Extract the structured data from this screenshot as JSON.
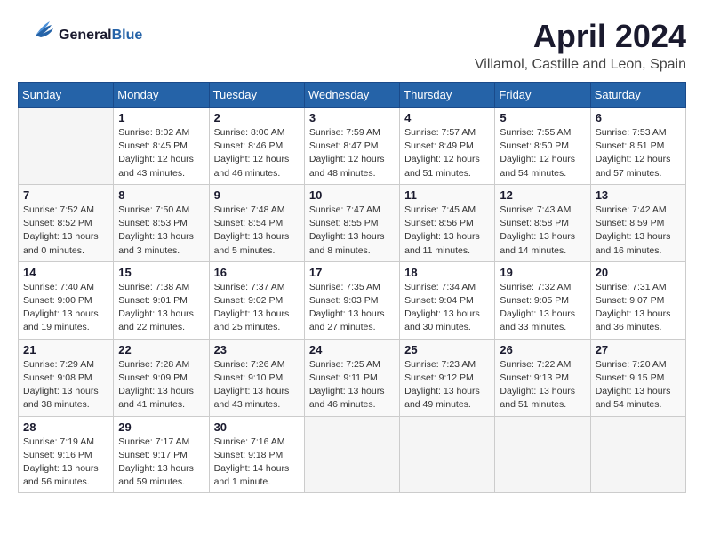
{
  "header": {
    "logo_line1": "General",
    "logo_line2": "Blue",
    "month_title": "April 2024",
    "location": "Villamol, Castille and Leon, Spain"
  },
  "weekdays": [
    "Sunday",
    "Monday",
    "Tuesday",
    "Wednesday",
    "Thursday",
    "Friday",
    "Saturday"
  ],
  "weeks": [
    [
      {
        "day": "",
        "info": ""
      },
      {
        "day": "1",
        "info": "Sunrise: 8:02 AM\nSunset: 8:45 PM\nDaylight: 12 hours\nand 43 minutes."
      },
      {
        "day": "2",
        "info": "Sunrise: 8:00 AM\nSunset: 8:46 PM\nDaylight: 12 hours\nand 46 minutes."
      },
      {
        "day": "3",
        "info": "Sunrise: 7:59 AM\nSunset: 8:47 PM\nDaylight: 12 hours\nand 48 minutes."
      },
      {
        "day": "4",
        "info": "Sunrise: 7:57 AM\nSunset: 8:49 PM\nDaylight: 12 hours\nand 51 minutes."
      },
      {
        "day": "5",
        "info": "Sunrise: 7:55 AM\nSunset: 8:50 PM\nDaylight: 12 hours\nand 54 minutes."
      },
      {
        "day": "6",
        "info": "Sunrise: 7:53 AM\nSunset: 8:51 PM\nDaylight: 12 hours\nand 57 minutes."
      }
    ],
    [
      {
        "day": "7",
        "info": "Sunrise: 7:52 AM\nSunset: 8:52 PM\nDaylight: 13 hours\nand 0 minutes."
      },
      {
        "day": "8",
        "info": "Sunrise: 7:50 AM\nSunset: 8:53 PM\nDaylight: 13 hours\nand 3 minutes."
      },
      {
        "day": "9",
        "info": "Sunrise: 7:48 AM\nSunset: 8:54 PM\nDaylight: 13 hours\nand 5 minutes."
      },
      {
        "day": "10",
        "info": "Sunrise: 7:47 AM\nSunset: 8:55 PM\nDaylight: 13 hours\nand 8 minutes."
      },
      {
        "day": "11",
        "info": "Sunrise: 7:45 AM\nSunset: 8:56 PM\nDaylight: 13 hours\nand 11 minutes."
      },
      {
        "day": "12",
        "info": "Sunrise: 7:43 AM\nSunset: 8:58 PM\nDaylight: 13 hours\nand 14 minutes."
      },
      {
        "day": "13",
        "info": "Sunrise: 7:42 AM\nSunset: 8:59 PM\nDaylight: 13 hours\nand 16 minutes."
      }
    ],
    [
      {
        "day": "14",
        "info": "Sunrise: 7:40 AM\nSunset: 9:00 PM\nDaylight: 13 hours\nand 19 minutes."
      },
      {
        "day": "15",
        "info": "Sunrise: 7:38 AM\nSunset: 9:01 PM\nDaylight: 13 hours\nand 22 minutes."
      },
      {
        "day": "16",
        "info": "Sunrise: 7:37 AM\nSunset: 9:02 PM\nDaylight: 13 hours\nand 25 minutes."
      },
      {
        "day": "17",
        "info": "Sunrise: 7:35 AM\nSunset: 9:03 PM\nDaylight: 13 hours\nand 27 minutes."
      },
      {
        "day": "18",
        "info": "Sunrise: 7:34 AM\nSunset: 9:04 PM\nDaylight: 13 hours\nand 30 minutes."
      },
      {
        "day": "19",
        "info": "Sunrise: 7:32 AM\nSunset: 9:05 PM\nDaylight: 13 hours\nand 33 minutes."
      },
      {
        "day": "20",
        "info": "Sunrise: 7:31 AM\nSunset: 9:07 PM\nDaylight: 13 hours\nand 36 minutes."
      }
    ],
    [
      {
        "day": "21",
        "info": "Sunrise: 7:29 AM\nSunset: 9:08 PM\nDaylight: 13 hours\nand 38 minutes."
      },
      {
        "day": "22",
        "info": "Sunrise: 7:28 AM\nSunset: 9:09 PM\nDaylight: 13 hours\nand 41 minutes."
      },
      {
        "day": "23",
        "info": "Sunrise: 7:26 AM\nSunset: 9:10 PM\nDaylight: 13 hours\nand 43 minutes."
      },
      {
        "day": "24",
        "info": "Sunrise: 7:25 AM\nSunset: 9:11 PM\nDaylight: 13 hours\nand 46 minutes."
      },
      {
        "day": "25",
        "info": "Sunrise: 7:23 AM\nSunset: 9:12 PM\nDaylight: 13 hours\nand 49 minutes."
      },
      {
        "day": "26",
        "info": "Sunrise: 7:22 AM\nSunset: 9:13 PM\nDaylight: 13 hours\nand 51 minutes."
      },
      {
        "day": "27",
        "info": "Sunrise: 7:20 AM\nSunset: 9:15 PM\nDaylight: 13 hours\nand 54 minutes."
      }
    ],
    [
      {
        "day": "28",
        "info": "Sunrise: 7:19 AM\nSunset: 9:16 PM\nDaylight: 13 hours\nand 56 minutes."
      },
      {
        "day": "29",
        "info": "Sunrise: 7:17 AM\nSunset: 9:17 PM\nDaylight: 13 hours\nand 59 minutes."
      },
      {
        "day": "30",
        "info": "Sunrise: 7:16 AM\nSunset: 9:18 PM\nDaylight: 14 hours\nand 1 minute."
      },
      {
        "day": "",
        "info": ""
      },
      {
        "day": "",
        "info": ""
      },
      {
        "day": "",
        "info": ""
      },
      {
        "day": "",
        "info": ""
      }
    ]
  ]
}
